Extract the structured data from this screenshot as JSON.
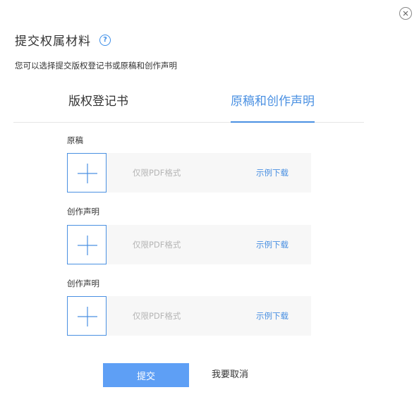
{
  "dialog": {
    "title": "提交权属材料",
    "help_icon_text": "?",
    "subtitle": "您可以选择提交版权登记书或原稿和创作声明",
    "close_icon": "close-icon"
  },
  "tabs": [
    {
      "label": "版权登记书",
      "active": false
    },
    {
      "label": "原稿和创作声明",
      "active": true
    }
  ],
  "uploads": [
    {
      "label": "原稿",
      "hint": "仅限PDF格式",
      "download_label": "示例下载"
    },
    {
      "label": "创作声明",
      "hint": "仅限PDF格式",
      "download_label": "示例下载"
    },
    {
      "label": "创作声明",
      "hint": "仅限PDF格式",
      "download_label": "示例下载"
    }
  ],
  "footer": {
    "submit_label": "提交",
    "cancel_label": "我要取消"
  },
  "colors": {
    "accent": "#4a90e2",
    "submit_bg": "#5e9ff5",
    "upload_bg": "#f7f7f7"
  }
}
